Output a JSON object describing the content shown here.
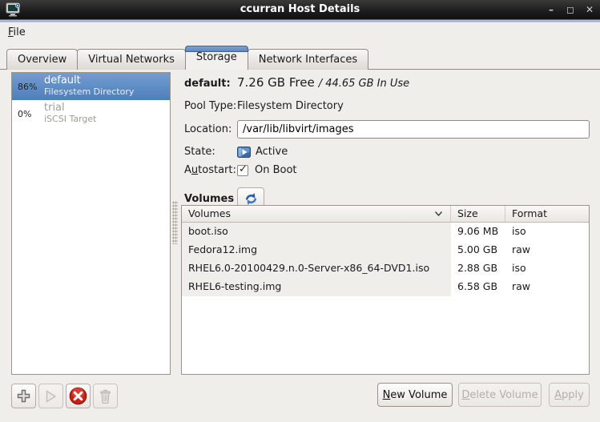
{
  "window": {
    "title": "ccurran Host Details",
    "controls": {
      "minimize": "–",
      "maximize": "◻",
      "close": "✕"
    }
  },
  "menu": {
    "file_label": "File"
  },
  "tabs": [
    {
      "label": "Overview"
    },
    {
      "label": "Virtual Networks"
    },
    {
      "label": "Storage"
    },
    {
      "label": "Network Interfaces"
    }
  ],
  "pools": [
    {
      "percent": "86%",
      "name": "default",
      "type": "Filesystem Directory"
    },
    {
      "percent": "0%",
      "name": "trial",
      "type": "iSCSI Target"
    }
  ],
  "details": {
    "pool_name": "default:",
    "free": "7.26 GB Free",
    "in_use": "/ 44.65 GB In Use",
    "pool_type_label": "Pool Type:",
    "pool_type": "Filesystem Directory",
    "location_label": "Location:",
    "location_value": "/var/lib/libvirt/images",
    "state_label": "State:",
    "state_value": "Active",
    "autostart_label": "Autostart:",
    "autostart_value": "On Boot",
    "volumes_label": "Volumes"
  },
  "volumes_table": {
    "columns": [
      "Volumes",
      "Size",
      "Format"
    ],
    "rows": [
      {
        "name": "boot.iso",
        "size": "9.06 MB",
        "format": "iso"
      },
      {
        "name": "Fedora12.img",
        "size": "5.00 GB",
        "format": "raw"
      },
      {
        "name": "RHEL6.0-20100429.n.0-Server-x86_64-DVD1.iso",
        "size": "2.88 GB",
        "format": "iso"
      },
      {
        "name": "RHEL6-testing.img",
        "size": "6.58 GB",
        "format": "raw"
      }
    ]
  },
  "actions": {
    "new_volume": "New Volume",
    "delete_volume": "Delete Volume",
    "apply": "Apply"
  },
  "colors": {
    "selection_top": "#729dd1",
    "selection_bottom": "#4e7eba",
    "tab_accent": "#5d87bd",
    "stop_red": "#c01010",
    "refresh_blue": "#2f5f9e"
  }
}
